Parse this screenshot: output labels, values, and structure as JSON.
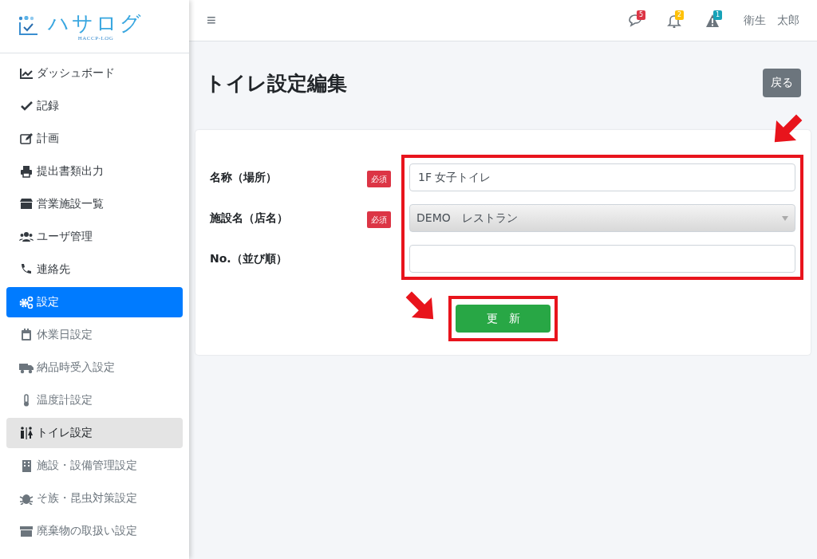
{
  "logo": {
    "name": "ハサログ",
    "tagline": "HACCP-LOG"
  },
  "sidebar": {
    "items": [
      {
        "label": "ダッシュボード",
        "kind": "main",
        "selected": false
      },
      {
        "label": "記録",
        "kind": "main",
        "selected": false
      },
      {
        "label": "計画",
        "kind": "main",
        "selected": false
      },
      {
        "label": "提出書類出力",
        "kind": "main",
        "selected": false
      },
      {
        "label": "営業施設一覧",
        "kind": "main",
        "selected": false
      },
      {
        "label": "ユーザ管理",
        "kind": "main",
        "selected": false
      },
      {
        "label": "連絡先",
        "kind": "main",
        "selected": false
      },
      {
        "label": "設定",
        "kind": "main",
        "selected": true
      },
      {
        "label": "休業日設定",
        "kind": "sub",
        "selected": false
      },
      {
        "label": "納品時受入設定",
        "kind": "sub",
        "selected": false
      },
      {
        "label": "温度計設定",
        "kind": "sub",
        "selected": false
      },
      {
        "label": "トイレ設定",
        "kind": "sub",
        "selected": true
      },
      {
        "label": "施設・設備管理設定",
        "kind": "sub",
        "selected": false
      },
      {
        "label": "そ族・昆虫対策設定",
        "kind": "sub",
        "selected": false
      },
      {
        "label": "廃棄物の取扱い設定",
        "kind": "sub",
        "selected": false
      }
    ]
  },
  "header": {
    "menu_glyph": "≡",
    "notifications": [
      {
        "count": "5",
        "color": "#dc3545"
      },
      {
        "count": "2",
        "color": "#ffc107"
      },
      {
        "count": "1",
        "color": "#17a2b8"
      }
    ],
    "user": "衛生　太郎"
  },
  "page": {
    "title": "トイレ設定編集",
    "back_button": "戻る"
  },
  "form": {
    "fields": [
      {
        "label": "名称（場所）",
        "required": true,
        "badge": "必須",
        "kind": "text",
        "value": "1F 女子トイレ"
      },
      {
        "label": "施設名（店名）",
        "required": true,
        "badge": "必須",
        "kind": "select",
        "value": "DEMO　レストラン"
      },
      {
        "label": "No.（並び順）",
        "required": false,
        "kind": "text"
      }
    ],
    "submit": "更　新"
  }
}
